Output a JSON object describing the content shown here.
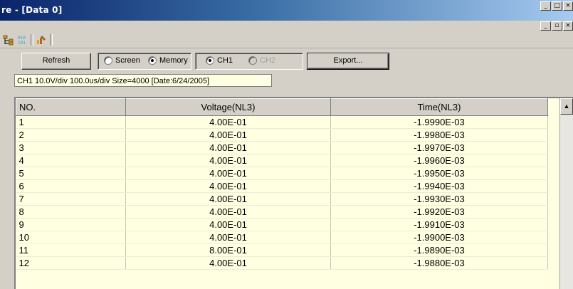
{
  "window": {
    "title": "re - [Data 0]",
    "controls": [
      "minimize",
      "restore",
      "close"
    ],
    "child_controls": [
      "minimize",
      "restore",
      "close"
    ]
  },
  "toolbar": {
    "icons": [
      "tree-icon",
      "binary-data-icon",
      "chart-tool-icon"
    ]
  },
  "controls": {
    "refresh_label": "Refresh",
    "source_options": [
      {
        "label": "Screen",
        "checked": false
      },
      {
        "label": "Memory",
        "checked": true
      }
    ],
    "channel_options": [
      {
        "label": "CH1",
        "checked": true,
        "enabled": true
      },
      {
        "label": "CH2",
        "checked": false,
        "enabled": false
      }
    ],
    "export_label": "Export..."
  },
  "info_text": "CH1 10.0V/div 100.0us/div Size=4000 [Date:6/24/2005]",
  "table": {
    "headers": [
      "NO.",
      "Voltage(NL3)",
      "Time(NL3)"
    ],
    "rows": [
      [
        "1",
        "4.00E-01",
        "-1.9990E-03"
      ],
      [
        "2",
        "4.00E-01",
        "-1.9980E-03"
      ],
      [
        "3",
        "4.00E-01",
        "-1.9970E-03"
      ],
      [
        "4",
        "4.00E-01",
        "-1.9960E-03"
      ],
      [
        "5",
        "4.00E-01",
        "-1.9950E-03"
      ],
      [
        "6",
        "4.00E-01",
        "-1.9940E-03"
      ],
      [
        "7",
        "4.00E-01",
        "-1.9930E-03"
      ],
      [
        "8",
        "4.00E-01",
        "-1.9920E-03"
      ],
      [
        "9",
        "4.00E-01",
        "-1.9910E-03"
      ],
      [
        "10",
        "4.00E-01",
        "-1.9900E-03"
      ],
      [
        "11",
        "8.00E-01",
        "-1.9890E-03"
      ],
      [
        "12",
        "4.00E-01",
        "-1.9880E-03"
      ]
    ]
  },
  "colors": {
    "grid_background": "#ffffe1",
    "title_gradient_start": "#0a246a",
    "title_gradient_end": "#a6caf0"
  }
}
